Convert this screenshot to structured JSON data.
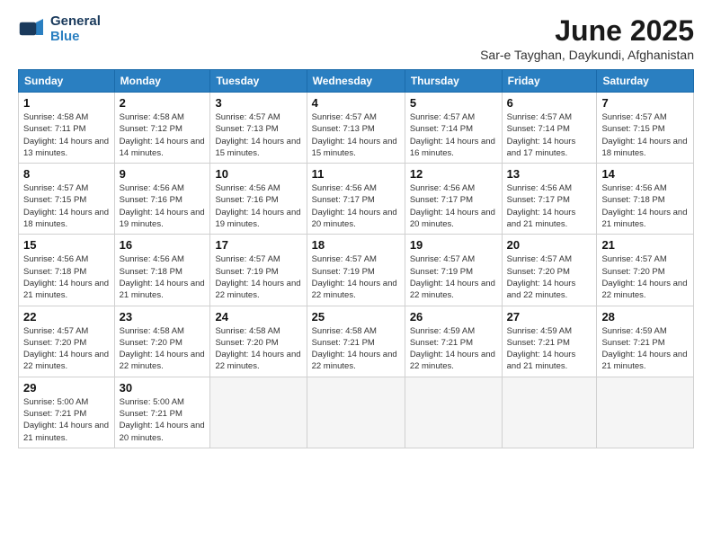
{
  "header": {
    "logo_line1": "General",
    "logo_line2": "Blue",
    "title": "June 2025",
    "subtitle": "Sar-e Tayghan, Daykundi, Afghanistan"
  },
  "weekdays": [
    "Sunday",
    "Monday",
    "Tuesday",
    "Wednesday",
    "Thursday",
    "Friday",
    "Saturday"
  ],
  "weeks": [
    [
      {
        "day": "1",
        "sunrise": "4:58 AM",
        "sunset": "7:11 PM",
        "daylight": "14 hours and 13 minutes."
      },
      {
        "day": "2",
        "sunrise": "4:58 AM",
        "sunset": "7:12 PM",
        "daylight": "14 hours and 14 minutes."
      },
      {
        "day": "3",
        "sunrise": "4:57 AM",
        "sunset": "7:13 PM",
        "daylight": "14 hours and 15 minutes."
      },
      {
        "day": "4",
        "sunrise": "4:57 AM",
        "sunset": "7:13 PM",
        "daylight": "14 hours and 15 minutes."
      },
      {
        "day": "5",
        "sunrise": "4:57 AM",
        "sunset": "7:14 PM",
        "daylight": "14 hours and 16 minutes."
      },
      {
        "day": "6",
        "sunrise": "4:57 AM",
        "sunset": "7:14 PM",
        "daylight": "14 hours and 17 minutes."
      },
      {
        "day": "7",
        "sunrise": "4:57 AM",
        "sunset": "7:15 PM",
        "daylight": "14 hours and 18 minutes."
      }
    ],
    [
      {
        "day": "8",
        "sunrise": "4:57 AM",
        "sunset": "7:15 PM",
        "daylight": "14 hours and 18 minutes."
      },
      {
        "day": "9",
        "sunrise": "4:56 AM",
        "sunset": "7:16 PM",
        "daylight": "14 hours and 19 minutes."
      },
      {
        "day": "10",
        "sunrise": "4:56 AM",
        "sunset": "7:16 PM",
        "daylight": "14 hours and 19 minutes."
      },
      {
        "day": "11",
        "sunrise": "4:56 AM",
        "sunset": "7:17 PM",
        "daylight": "14 hours and 20 minutes."
      },
      {
        "day": "12",
        "sunrise": "4:56 AM",
        "sunset": "7:17 PM",
        "daylight": "14 hours and 20 minutes."
      },
      {
        "day": "13",
        "sunrise": "4:56 AM",
        "sunset": "7:17 PM",
        "daylight": "14 hours and 21 minutes."
      },
      {
        "day": "14",
        "sunrise": "4:56 AM",
        "sunset": "7:18 PM",
        "daylight": "14 hours and 21 minutes."
      }
    ],
    [
      {
        "day": "15",
        "sunrise": "4:56 AM",
        "sunset": "7:18 PM",
        "daylight": "14 hours and 21 minutes."
      },
      {
        "day": "16",
        "sunrise": "4:56 AM",
        "sunset": "7:18 PM",
        "daylight": "14 hours and 21 minutes."
      },
      {
        "day": "17",
        "sunrise": "4:57 AM",
        "sunset": "7:19 PM",
        "daylight": "14 hours and 22 minutes."
      },
      {
        "day": "18",
        "sunrise": "4:57 AM",
        "sunset": "7:19 PM",
        "daylight": "14 hours and 22 minutes."
      },
      {
        "day": "19",
        "sunrise": "4:57 AM",
        "sunset": "7:19 PM",
        "daylight": "14 hours and 22 minutes."
      },
      {
        "day": "20",
        "sunrise": "4:57 AM",
        "sunset": "7:20 PM",
        "daylight": "14 hours and 22 minutes."
      },
      {
        "day": "21",
        "sunrise": "4:57 AM",
        "sunset": "7:20 PM",
        "daylight": "14 hours and 22 minutes."
      }
    ],
    [
      {
        "day": "22",
        "sunrise": "4:57 AM",
        "sunset": "7:20 PM",
        "daylight": "14 hours and 22 minutes."
      },
      {
        "day": "23",
        "sunrise": "4:58 AM",
        "sunset": "7:20 PM",
        "daylight": "14 hours and 22 minutes."
      },
      {
        "day": "24",
        "sunrise": "4:58 AM",
        "sunset": "7:20 PM",
        "daylight": "14 hours and 22 minutes."
      },
      {
        "day": "25",
        "sunrise": "4:58 AM",
        "sunset": "7:21 PM",
        "daylight": "14 hours and 22 minutes."
      },
      {
        "day": "26",
        "sunrise": "4:59 AM",
        "sunset": "7:21 PM",
        "daylight": "14 hours and 22 minutes."
      },
      {
        "day": "27",
        "sunrise": "4:59 AM",
        "sunset": "7:21 PM",
        "daylight": "14 hours and 21 minutes."
      },
      {
        "day": "28",
        "sunrise": "4:59 AM",
        "sunset": "7:21 PM",
        "daylight": "14 hours and 21 minutes."
      }
    ],
    [
      {
        "day": "29",
        "sunrise": "5:00 AM",
        "sunset": "7:21 PM",
        "daylight": "14 hours and 21 minutes."
      },
      {
        "day": "30",
        "sunrise": "5:00 AM",
        "sunset": "7:21 PM",
        "daylight": "14 hours and 20 minutes."
      },
      null,
      null,
      null,
      null,
      null
    ]
  ],
  "labels": {
    "sunrise": "Sunrise:",
    "sunset": "Sunset:",
    "daylight": "Daylight:"
  }
}
